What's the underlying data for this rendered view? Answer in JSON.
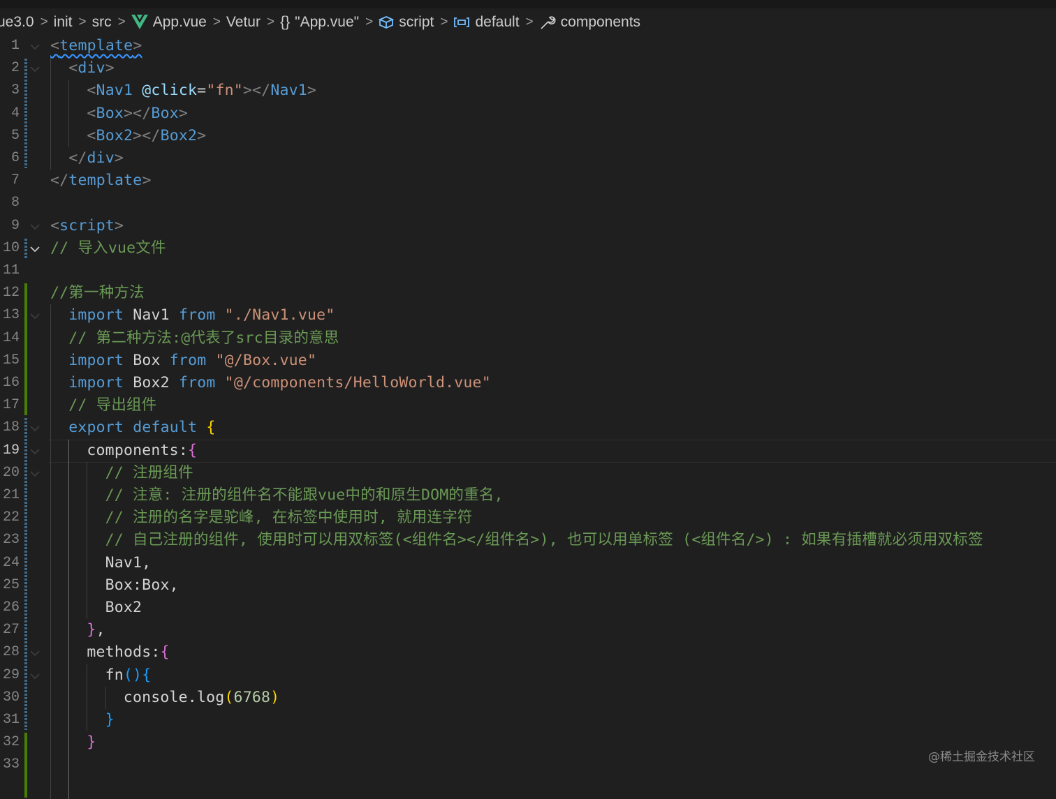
{
  "breadcrumb": {
    "items": [
      {
        "label": "ue3.0",
        "icon": ""
      },
      {
        "label": "init",
        "icon": ""
      },
      {
        "label": "src",
        "icon": ""
      },
      {
        "label": "App.vue",
        "icon": "vue-logo-icon"
      },
      {
        "label": "Vetur",
        "icon": ""
      },
      {
        "label": "\"App.vue\"",
        "icon": "braces-icon"
      },
      {
        "label": "script",
        "icon": "cube-icon"
      },
      {
        "label": "default",
        "icon": "variable-icon"
      },
      {
        "label": "components",
        "icon": "wrench-icon"
      }
    ]
  },
  "colors": {
    "background": "#1f1f1f",
    "keyword": "#569cd6",
    "string": "#ce9178",
    "comment": "#6a9955",
    "number": "#b5cea8",
    "bracket_gold": "#ffd700",
    "bracket_purple": "#da70d6",
    "bracket_blue": "#179fff"
  },
  "editor": {
    "active_line": 19,
    "lines": [
      {
        "n": "1",
        "tokens": [
          [
            "t-tag squiggle",
            "<"
          ],
          [
            "t-tagname squiggle",
            "template"
          ],
          [
            "t-tag squiggle",
            ">"
          ]
        ]
      },
      {
        "n": "2",
        "tokens": [
          [
            "t-tag",
            "<"
          ],
          [
            "t-tagname",
            "div"
          ],
          [
            "t-tag",
            ">"
          ]
        ]
      },
      {
        "n": "3",
        "tokens": [
          [
            "t-tag",
            "<"
          ],
          [
            "t-tagname",
            "Nav1 "
          ],
          [
            "t-attr",
            "@click"
          ],
          [
            "t-id",
            "="
          ],
          [
            "t-str",
            "\"fn\""
          ],
          [
            "t-tag",
            "></"
          ],
          [
            "t-tagname",
            "Nav1"
          ],
          [
            "t-tag",
            ">"
          ]
        ]
      },
      {
        "n": "4",
        "tokens": [
          [
            "t-tag",
            "<"
          ],
          [
            "t-tagname",
            "Box"
          ],
          [
            "t-tag",
            "></"
          ],
          [
            "t-tagname",
            "Box"
          ],
          [
            "t-tag",
            ">"
          ]
        ]
      },
      {
        "n": "5",
        "tokens": [
          [
            "t-tag",
            "<"
          ],
          [
            "t-tagname",
            "Box2"
          ],
          [
            "t-tag",
            "></"
          ],
          [
            "t-tagname",
            "Box2"
          ],
          [
            "t-tag",
            ">"
          ]
        ]
      },
      {
        "n": "6",
        "tokens": [
          [
            "t-tag",
            "</"
          ],
          [
            "t-tagname",
            "div"
          ],
          [
            "t-tag",
            ">"
          ]
        ]
      },
      {
        "n": "7",
        "tokens": [
          [
            "t-tag",
            "</"
          ],
          [
            "t-tagname",
            "template"
          ],
          [
            "t-tag",
            ">"
          ]
        ]
      },
      {
        "n": "8",
        "tokens": []
      },
      {
        "n": "9",
        "tokens": [
          [
            "t-tag",
            "<"
          ],
          [
            "t-tagname",
            "script"
          ],
          [
            "t-tag",
            ">"
          ]
        ]
      },
      {
        "n": "10",
        "tokens": [
          [
            "t-com",
            "// 导入vue文件"
          ]
        ]
      },
      {
        "n": "11",
        "tokens": []
      },
      {
        "n": "12",
        "tokens": [
          [
            "t-com",
            "//第一种方法"
          ]
        ]
      },
      {
        "n": "13",
        "tokens": [
          [
            "t-kw",
            "import "
          ],
          [
            "t-id",
            "Nav1 "
          ],
          [
            "t-kw",
            "from "
          ],
          [
            "t-str",
            "\"./Nav1.vue\""
          ]
        ]
      },
      {
        "n": "14",
        "tokens": [
          [
            "t-com",
            "// 第二种方法:@代表了src目录的意思"
          ]
        ]
      },
      {
        "n": "15",
        "tokens": [
          [
            "t-kw",
            "import "
          ],
          [
            "t-id",
            "Box "
          ],
          [
            "t-kw",
            "from "
          ],
          [
            "t-str",
            "\"@/Box.vue\""
          ]
        ]
      },
      {
        "n": "16",
        "tokens": [
          [
            "t-kw",
            "import "
          ],
          [
            "t-id",
            "Box2 "
          ],
          [
            "t-kw",
            "from "
          ],
          [
            "t-str",
            "\"@/components/HelloWorld.vue\""
          ]
        ]
      },
      {
        "n": "17",
        "tokens": [
          [
            "t-com",
            "// 导出组件"
          ]
        ]
      },
      {
        "n": "18",
        "tokens": [
          [
            "t-kw",
            "export "
          ],
          [
            "t-kw",
            "default "
          ],
          [
            "t-b1",
            "{"
          ]
        ]
      },
      {
        "n": "19",
        "tokens": [
          [
            "t-id",
            "components:"
          ],
          [
            "t-b2",
            "{"
          ]
        ]
      },
      {
        "n": "20",
        "tokens": [
          [
            "t-com",
            "// 注册组件"
          ]
        ]
      },
      {
        "n": "21",
        "tokens": [
          [
            "t-com",
            "// 注意: 注册的组件名不能跟vue中的和原生DOM的重名,"
          ]
        ]
      },
      {
        "n": "22",
        "tokens": [
          [
            "t-com",
            "// 注册的名字是驼峰, 在标签中使用时, 就用连字符"
          ]
        ]
      },
      {
        "n": "23",
        "tokens": [
          [
            "t-com",
            "// 自己注册的组件, 使用时可以用双标签(<组件名></组件名>), 也可以用单标签 (<组件名/>) : 如果有插槽就必须用双标签"
          ]
        ]
      },
      {
        "n": "24",
        "tokens": [
          [
            "t-id",
            "Nav1,"
          ]
        ]
      },
      {
        "n": "25",
        "tokens": [
          [
            "t-id",
            "Box:Box,"
          ]
        ]
      },
      {
        "n": "26",
        "tokens": [
          [
            "t-id",
            "Box2"
          ]
        ]
      },
      {
        "n": "27",
        "tokens": [
          [
            "t-b2",
            "}"
          ],
          [
            "t-id",
            ","
          ]
        ]
      },
      {
        "n": "28",
        "tokens": [
          [
            "t-id",
            "methods:"
          ],
          [
            "t-b2",
            "{"
          ]
        ]
      },
      {
        "n": "29",
        "tokens": [
          [
            "t-id",
            "fn"
          ],
          [
            "t-b3",
            "()"
          ],
          [
            "t-b3",
            "{"
          ]
        ]
      },
      {
        "n": "30",
        "tokens": [
          [
            "t-id",
            "console.log"
          ],
          [
            "t-b1",
            "("
          ],
          [
            "t-num",
            "6768"
          ],
          [
            "t-b1",
            ")"
          ]
        ]
      },
      {
        "n": "31",
        "tokens": [
          [
            "t-b3",
            "}"
          ]
        ]
      },
      {
        "n": "32",
        "tokens": [
          [
            "t-b2",
            "}"
          ]
        ]
      },
      {
        "n": "33",
        "tokens": []
      }
    ]
  },
  "watermark": "@稀土掘金技术社区"
}
